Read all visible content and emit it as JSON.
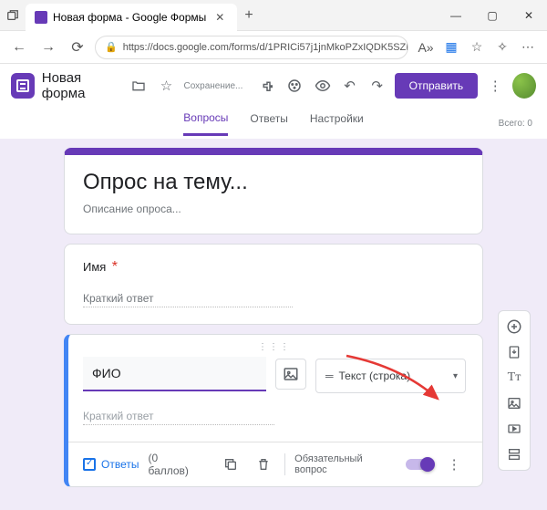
{
  "browser": {
    "tab_title": "Новая форма - Google Формы",
    "url": "https://docs.google.com/forms/d/1PRICi57j1jnMkoPZxIQDK5SZBJEQRBTO..."
  },
  "header": {
    "form_name": "Новая форма",
    "saving_text": "Сохранение...",
    "send_button": "Отправить"
  },
  "tabs": {
    "questions": "Вопросы",
    "responses": "Ответы",
    "settings": "Настройки",
    "total": "Всего: 0"
  },
  "title_card": {
    "title": "Опрос на тему...",
    "description": "Описание опроса..."
  },
  "question1": {
    "label": "Имя",
    "answer_hint": "Краткий ответ"
  },
  "question2": {
    "title": "ФИО",
    "type_label": "Текст (строка)",
    "answer_hint": "Краткий ответ",
    "answer_key": "Ответы",
    "points": "(0 баллов)",
    "required_label": "Обязательный вопрос"
  }
}
